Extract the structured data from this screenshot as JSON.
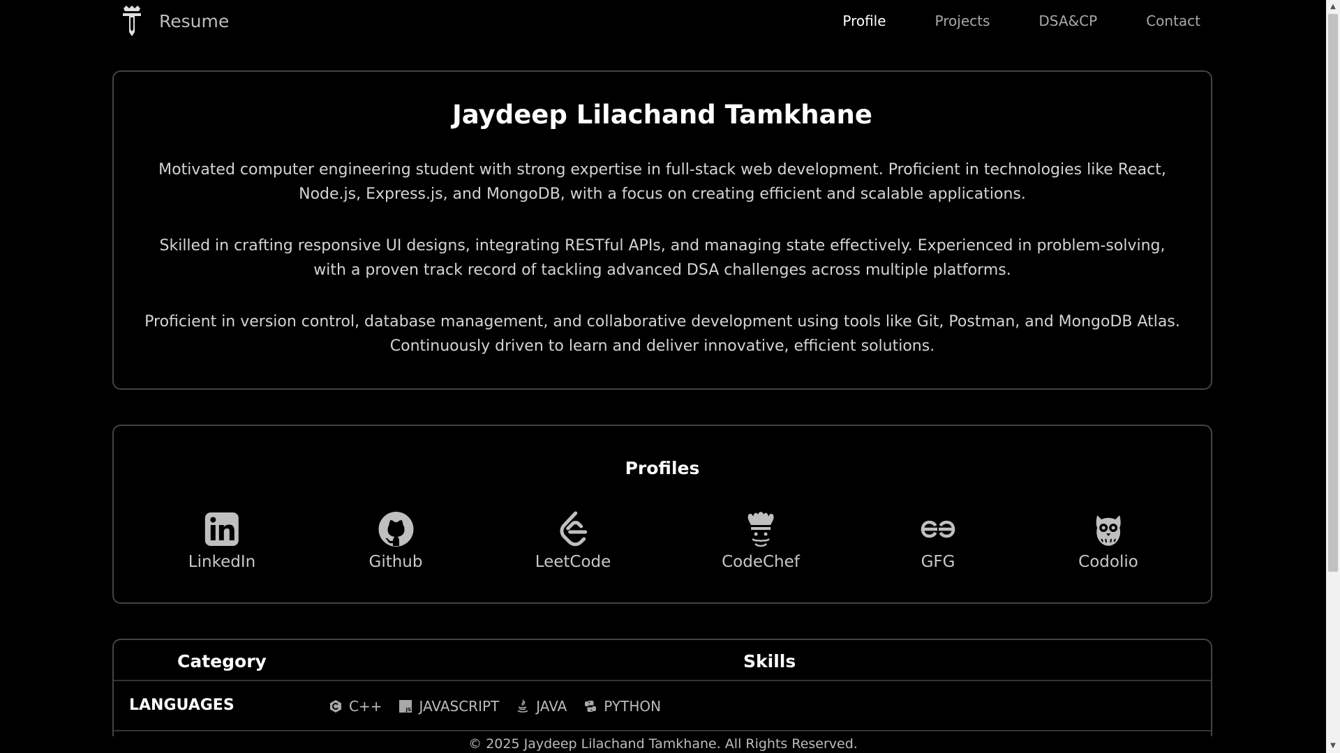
{
  "nav": {
    "brand_label": "Resume",
    "links": [
      "Profile",
      "Projects",
      "DSA&CP",
      "Contact"
    ],
    "active": "Profile"
  },
  "about": {
    "name": "Jaydeep Lilachand Tamkhane",
    "paragraphs": [
      "Motivated computer engineering student with strong expertise in full-stack web development. Proficient in technologies like React, Node.js, Express.js, and MongoDB, with a focus on creating efficient and scalable applications.",
      "Skilled in crafting responsive UI designs, integrating RESTful APIs, and managing state effectively. Experienced in problem-solving, with a proven track record of tackling advanced DSA challenges across multiple platforms.",
      "Proficient in version control, database management, and collaborative development using tools like Git, Postman, and MongoDB Atlas. Continuously driven to learn and deliver innovative, efficient solutions."
    ]
  },
  "profiles": {
    "title": "Profiles",
    "items": [
      {
        "label": "LinkedIn",
        "icon": "linkedin-icon"
      },
      {
        "label": "Github",
        "icon": "github-icon"
      },
      {
        "label": "LeetCode",
        "icon": "leetcode-icon"
      },
      {
        "label": "CodeChef",
        "icon": "codechef-icon"
      },
      {
        "label": "GFG",
        "icon": "gfg-icon"
      },
      {
        "label": "Codolio",
        "icon": "codolio-icon"
      }
    ]
  },
  "skills": {
    "headers": {
      "category": "Category",
      "skills": "Skills"
    },
    "rows": [
      {
        "category": "LANGUAGES",
        "items": [
          {
            "label": "C++",
            "icon": "cpp-icon"
          },
          {
            "label": "JAVASCRIPT",
            "icon": "javascript-icon"
          },
          {
            "label": "JAVA",
            "icon": "java-icon"
          },
          {
            "label": "PYTHON",
            "icon": "python-icon"
          }
        ]
      }
    ]
  },
  "footer": {
    "text": "© 2025 Jaydeep Lilachand Tamkhane. All Rights Reserved."
  },
  "colors": {
    "background": "#000000",
    "border": "#444444",
    "text": "#e8e8e8"
  }
}
